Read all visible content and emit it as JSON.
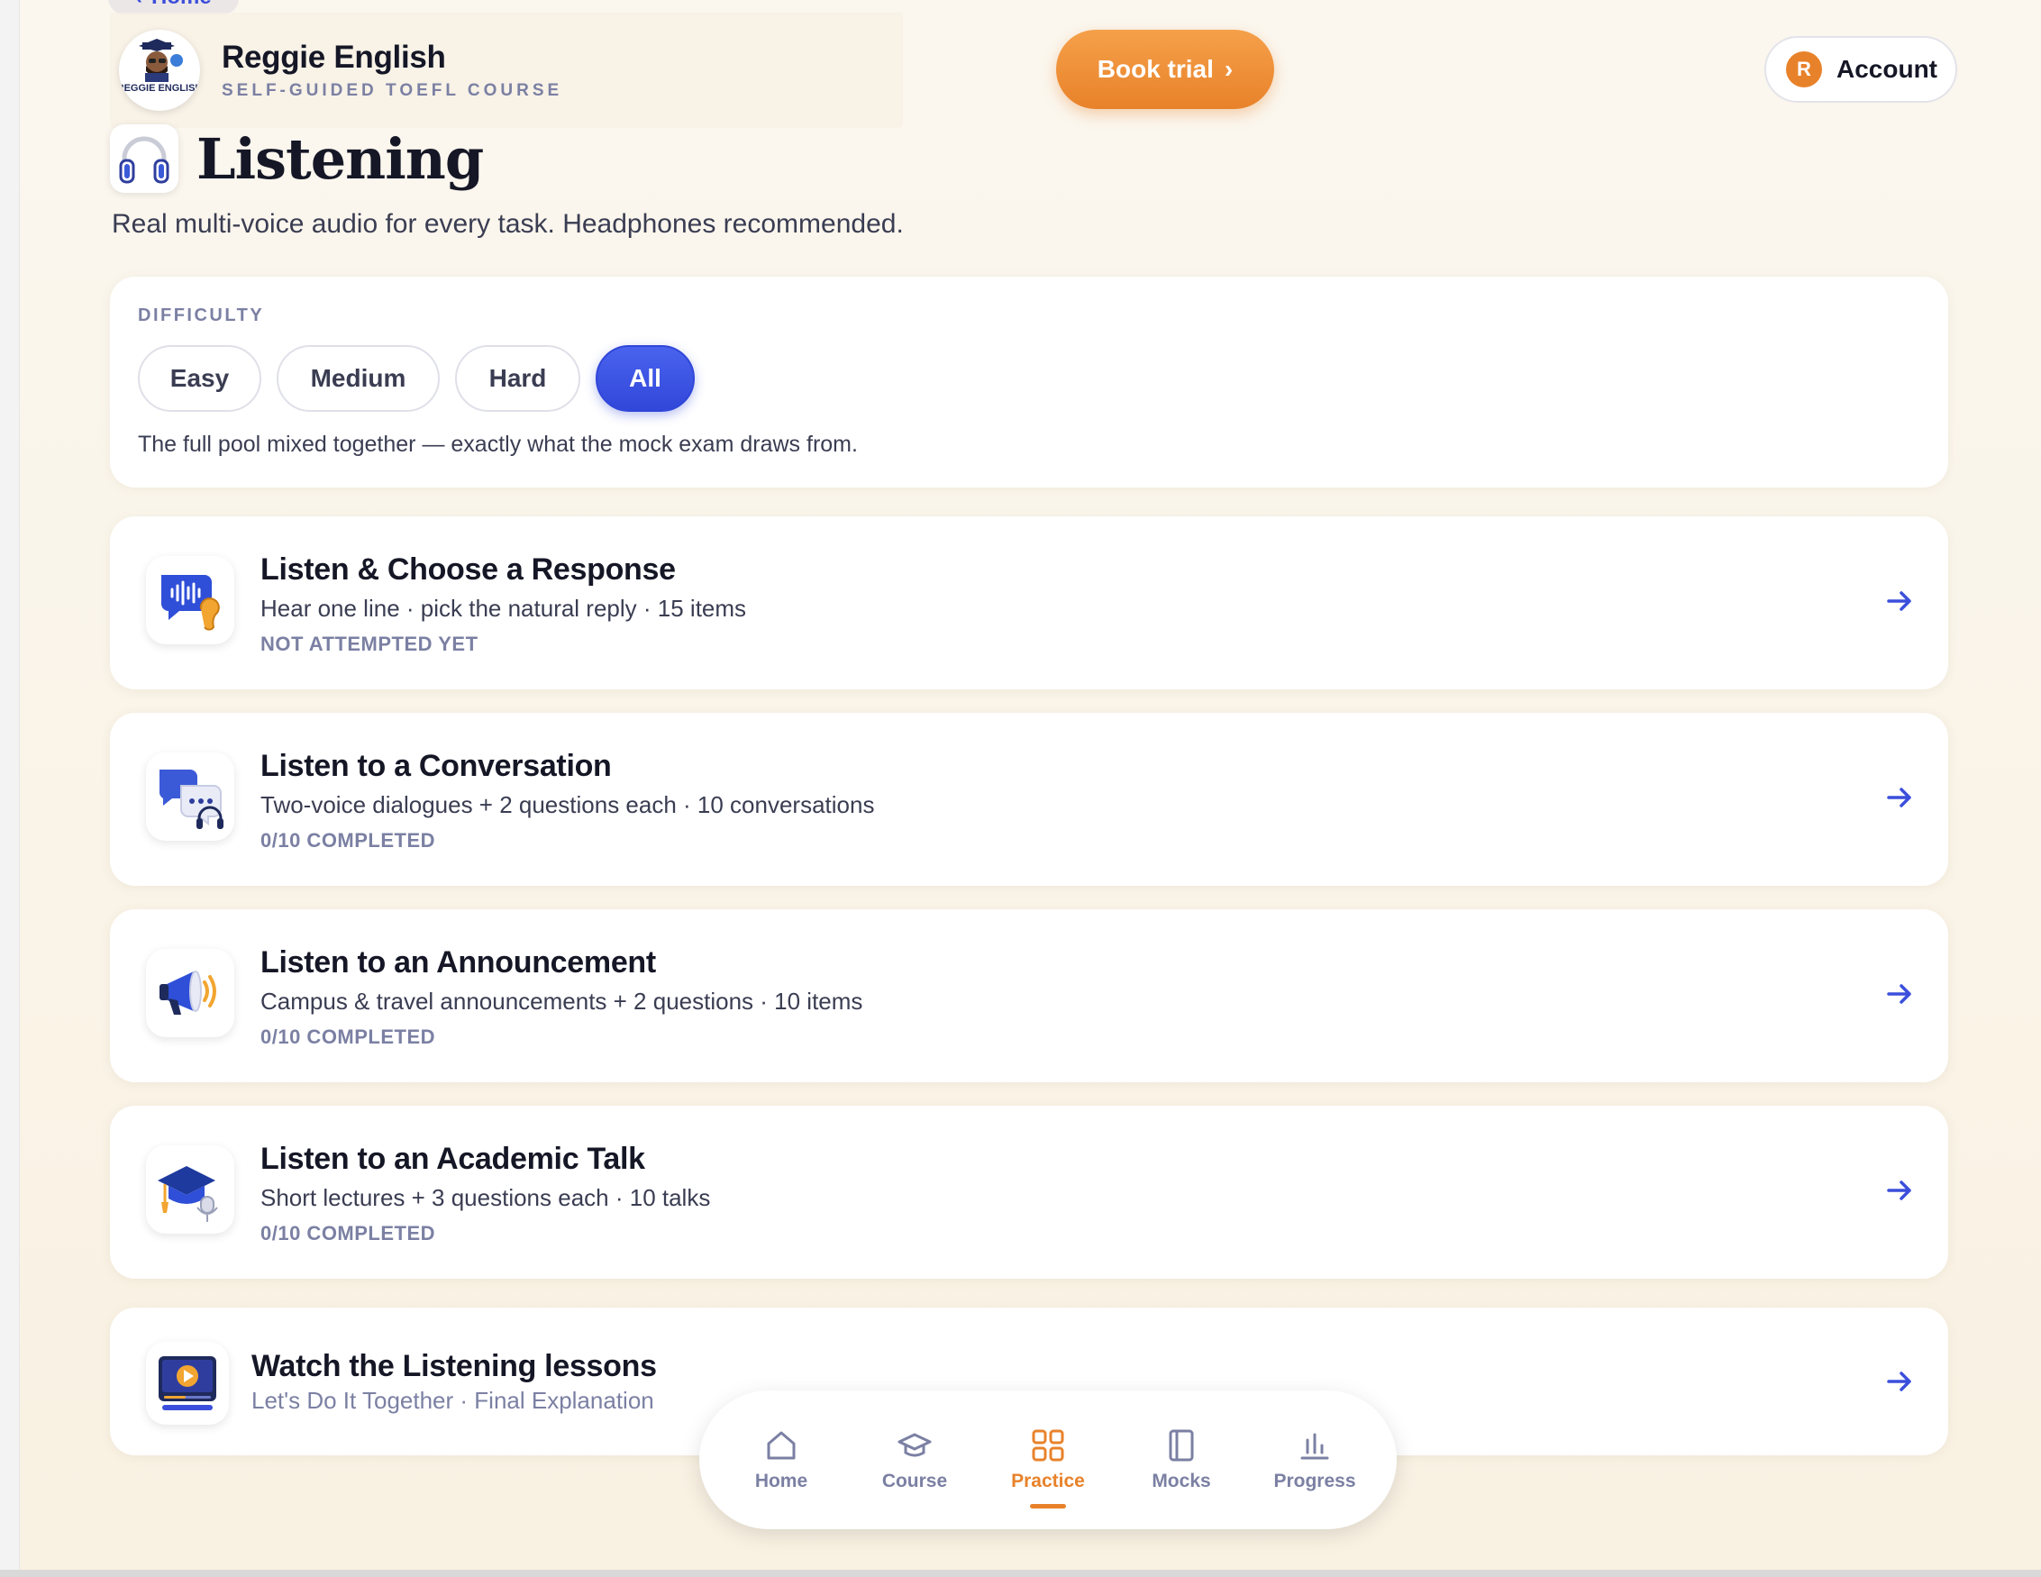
{
  "back_link": {
    "label": "Home"
  },
  "header": {
    "brand_name": "Reggie English",
    "brand_sub": "SELF-GUIDED TOEFL COURSE",
    "logo_text": "REGGIE ENGLISH",
    "book_trial": "Book trial",
    "account_initial": "R",
    "account_label": "Account"
  },
  "page": {
    "title": "Listening",
    "subtitle": "Real multi-voice audio for every task. Headphones recommended."
  },
  "difficulty": {
    "label": "DIFFICULTY",
    "options": [
      "Easy",
      "Medium",
      "Hard",
      "All"
    ],
    "selected": "All",
    "description": "The full pool mixed together — exactly what the mock exam draws from."
  },
  "tasks": [
    {
      "title": "Listen & Choose a Response",
      "desc": "Hear one line · pick the natural reply · 15 items",
      "status": "NOT ATTEMPTED YET",
      "icon": "voice-ear-icon"
    },
    {
      "title": "Listen to a Conversation",
      "desc": "Two-voice dialogues + 2 questions each · 10 conversations",
      "status": "0/10 COMPLETED",
      "icon": "conversation-headphones-icon"
    },
    {
      "title": "Listen to an Announcement",
      "desc": "Campus & travel announcements + 2 questions · 10 items",
      "status": "0/10 COMPLETED",
      "icon": "megaphone-icon"
    },
    {
      "title": "Listen to an Academic Talk",
      "desc": "Short lectures + 3 questions each · 10 talks",
      "status": "0/10 COMPLETED",
      "icon": "graduation-mic-icon"
    }
  ],
  "lessons": {
    "title": "Watch the Listening lessons",
    "desc": "Let's Do It Together · Final Explanation",
    "icon": "video-player-icon"
  },
  "nav": {
    "items": [
      {
        "label": "Home",
        "icon": "home-icon"
      },
      {
        "label": "Course",
        "icon": "course-cap-icon"
      },
      {
        "label": "Practice",
        "icon": "grid-icon"
      },
      {
        "label": "Mocks",
        "icon": "book-icon"
      },
      {
        "label": "Progress",
        "icon": "bar-chart-icon"
      }
    ],
    "active": "Practice"
  },
  "colors": {
    "accent_orange": "#e8822a",
    "accent_blue": "#3147d9",
    "muted": "#7b80a3"
  }
}
